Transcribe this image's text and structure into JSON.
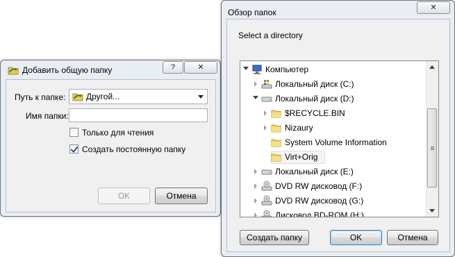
{
  "share_dialog": {
    "title": "Добавить общую папку",
    "help_button": "?",
    "path_label": "Путь к папке:",
    "path_value": "Другой...",
    "name_label": "Имя папки:",
    "name_value": "",
    "readonly_label": "Только для чтения",
    "readonly_checked": false,
    "permanent_label": "Создать постоянную папку",
    "permanent_checked": true,
    "ok_label": "OK",
    "cancel_label": "Отмена"
  },
  "browse_dialog": {
    "title": "Обзор папок",
    "prompt": "Select a directory",
    "tree": [
      {
        "label": "Компьютер",
        "icon": "computer-icon",
        "expanded": true
      },
      {
        "label": "Локальный диск (C:)",
        "icon": "windows-drive-icon",
        "expanded": false
      },
      {
        "label": "Локальный диск (D:)",
        "icon": "hard-drive-icon",
        "expanded": true
      },
      {
        "label": "$RECYCLE.BIN",
        "icon": "folder-icon",
        "expanded": false
      },
      {
        "label": "Nizaury",
        "icon": "folder-icon",
        "expanded": false
      },
      {
        "label": "System Volume Information",
        "icon": "folder-icon",
        "expanded": null
      },
      {
        "label": "Virt+Orig",
        "icon": "folder-icon",
        "expanded": null,
        "selected": true
      },
      {
        "label": "Локальный диск (E:)",
        "icon": "hard-drive-icon",
        "expanded": false
      },
      {
        "label": "DVD RW дисковод (F:)",
        "icon": "dvd-drive-icon",
        "expanded": false
      },
      {
        "label": "DVD RW дисковод (G:)",
        "icon": "dvd-drive-icon",
        "expanded": false
      },
      {
        "label": "Дисковод BD-ROM (H:)",
        "icon": "dvd-drive-icon",
        "expanded": false
      }
    ],
    "new_folder_label": "Создать папку",
    "ok_label": "OK",
    "cancel_label": "Отмена"
  }
}
